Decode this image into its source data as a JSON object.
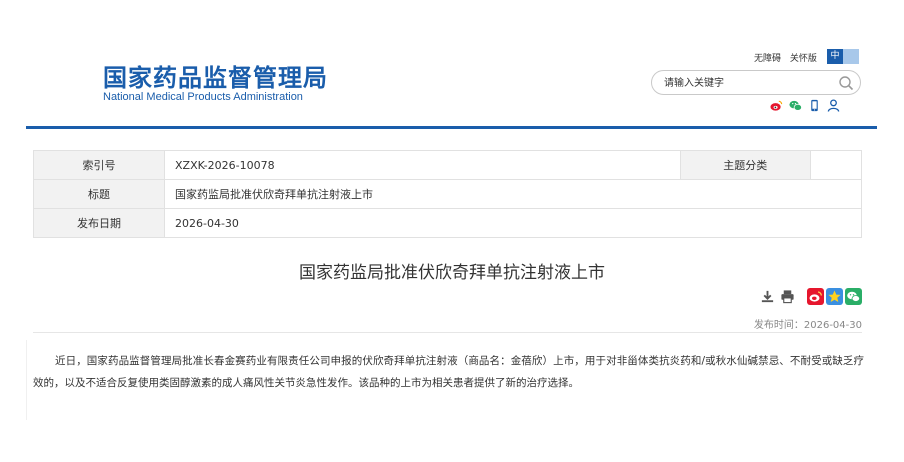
{
  "header": {
    "logo_cn": "国家药品监督管理局",
    "logo_en": "National Medical Products Administration",
    "links": [
      "无障碍",
      "关怀版"
    ],
    "lang": {
      "active": "中",
      "inactive": "EN"
    },
    "search": {
      "placeholder": "请输入关键字"
    },
    "share_icons": [
      "weibo-icon",
      "wechat-icon",
      "mobile-icon",
      "person-icon"
    ],
    "brand_color": "#1a5dab"
  },
  "meta": {
    "index_label": "索引号",
    "index_value": "XZXK-2026-10078",
    "topic_label": "主题分类",
    "topic_value": "",
    "title_label": "标题",
    "title_value": "国家药监局批准伏欣奇拜单抗注射液上市",
    "date_label": "发布日期",
    "date_value": "2026-04-30"
  },
  "article": {
    "title": "国家药监局批准伏欣奇拜单抗注射液上市",
    "publish_time": "发布时间：2026-04-30",
    "body": "近日，国家药品监督管理局批准长春金赛药业有限责任公司申报的伏欣奇拜单抗注射液（商品名：金蓓欣）上市，用于对非甾体类抗炎药和/或秋水仙碱禁忌、不耐受或缺乏疗效的，以及不适合反复使用类固醇激素的成人痛风性关节炎急性发作。该品种的上市为相关患者提供了新的治疗选择。",
    "tool_icons": [
      "download-icon",
      "print-icon"
    ],
    "share_icons": [
      "weibo-icon",
      "qzone-icon",
      "wechat-icon"
    ]
  }
}
